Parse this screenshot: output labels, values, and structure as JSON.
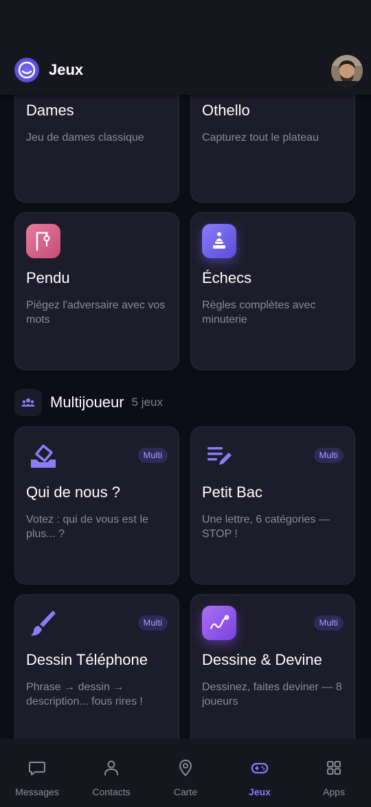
{
  "header": {
    "title": "Jeux"
  },
  "top_cards": [
    {
      "title": "Dames",
      "desc": "Jeu de dames classique"
    },
    {
      "title": "Othello",
      "desc": "Capturez tout le plateau"
    },
    {
      "title": "Pendu",
      "desc": "Piégez l'adversaire avec vos mots",
      "icon": "hangman-icon"
    },
    {
      "title": "Échecs",
      "desc": "Règles complètes avec minuterie",
      "icon": "chess-pawn-icon"
    }
  ],
  "section": {
    "title": "Multijoueur",
    "count": "5 jeux",
    "icon": "group-icon"
  },
  "multi_cards": [
    {
      "title": "Qui de nous ?",
      "desc": "Votez : qui de vous est le plus... ?",
      "badge": "Multi",
      "icon": "ballot-box-icon"
    },
    {
      "title": "Petit Bac",
      "desc": "Une lettre, 6 catégories — STOP !",
      "badge": "Multi",
      "icon": "edit-list-icon"
    },
    {
      "title": "Dessin Téléphone",
      "desc": "Phrase → dessin → description... fous rires !",
      "badge": "Multi",
      "icon": "brush-icon"
    },
    {
      "title": "Dessine & Devine",
      "desc": "Dessinez, faites deviner — 8 joueurs",
      "badge": "Multi",
      "icon": "draw-curve-icon"
    }
  ],
  "nav": [
    {
      "label": "Messages",
      "icon": "chat-icon"
    },
    {
      "label": "Contacts",
      "icon": "person-icon"
    },
    {
      "label": "Carte",
      "icon": "map-pin-icon"
    },
    {
      "label": "Jeux",
      "icon": "gamepad-icon",
      "active": true
    },
    {
      "label": "Apps",
      "icon": "grid-icon"
    }
  ],
  "colors": {
    "accent": "#8b7df8",
    "background": "#0d0d17",
    "card": "#1d1c2a"
  }
}
